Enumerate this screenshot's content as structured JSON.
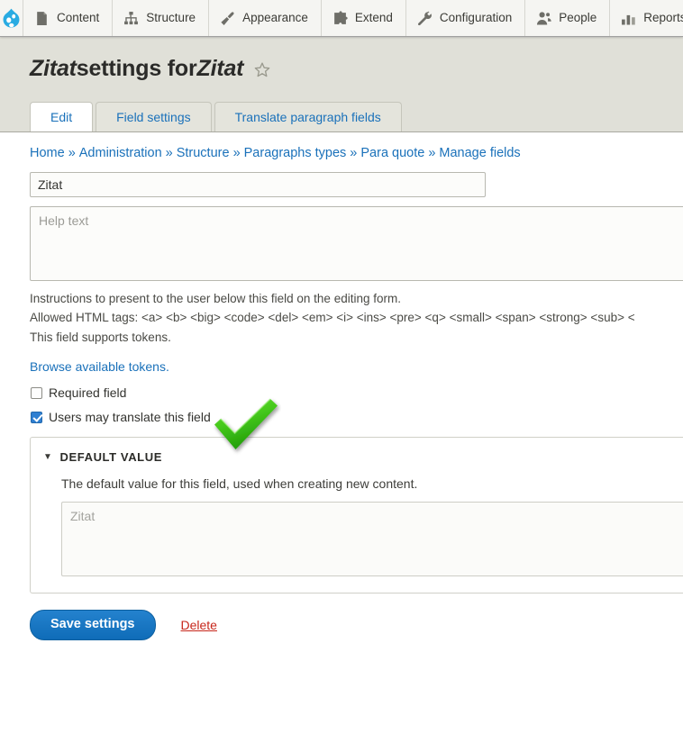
{
  "toolbar": {
    "home_icon": "drupal-droplet-logo",
    "items": [
      {
        "label": "Content",
        "icon": "document-icon"
      },
      {
        "label": "Structure",
        "icon": "hierarchy-icon"
      },
      {
        "label": "Appearance",
        "icon": "paintbrush-icon"
      },
      {
        "label": "Extend",
        "icon": "puzzle-piece-icon"
      },
      {
        "label": "Configuration",
        "icon": "wrench-icon"
      },
      {
        "label": "People",
        "icon": "people-icon"
      },
      {
        "label": "Reports",
        "icon": "bar-chart-icon"
      }
    ]
  },
  "header": {
    "title_part1": "Zitat",
    "title_part2": " settings for ",
    "title_part3": "Zitat",
    "star_icon": "star-outline-icon"
  },
  "tabs": [
    {
      "label": "Edit",
      "active": true
    },
    {
      "label": "Field settings",
      "active": false
    },
    {
      "label": "Translate paragraph fields",
      "active": false
    }
  ],
  "breadcrumb": {
    "separator": "»",
    "items": [
      "Home",
      "Administration",
      "Structure",
      "Paragraphs types",
      "Para quote",
      "Manage fields"
    ]
  },
  "form": {
    "label_input_value": "Zitat",
    "help_text_placeholder": "Help text",
    "description_lines": [
      "Instructions to present to the user below this field on the editing form.",
      "Allowed HTML tags: <a> <b> <big> <code> <del> <em> <i> <ins> <pre> <q> <small> <span> <strong> <sub> <",
      "This field supports tokens."
    ],
    "tokens_link": "Browse available tokens.",
    "required_field_label": "Required field",
    "required_field_checked": false,
    "translate_field_label": "Users may translate this field",
    "translate_field_checked": true
  },
  "default_value": {
    "collapse_arrow": "▼",
    "legend": "DEFAULT VALUE",
    "description": "The default value for this field, used when creating new content.",
    "textarea_placeholder": "Zitat"
  },
  "actions": {
    "save_label": "Save settings",
    "delete_label": "Delete"
  },
  "annotation": {
    "type": "green-checkmark-overlay"
  },
  "colors": {
    "link": "#1a71ba",
    "header_bg": "#e0e0d8",
    "primary_button": "#1877c4",
    "delete_link": "#c7261a",
    "checkmark_green": "#3fbf1e",
    "drupal_blue": "#29abe2"
  }
}
